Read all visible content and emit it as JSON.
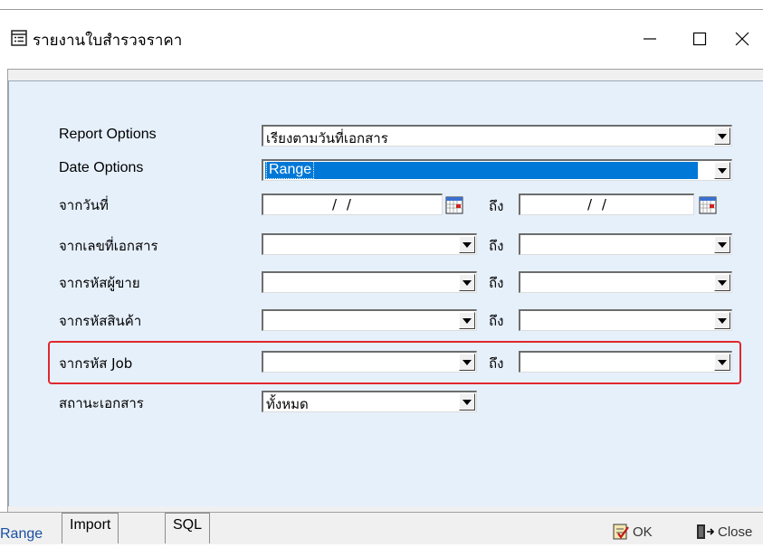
{
  "window": {
    "title": "รายงานใบสำรวจราคา",
    "icon": "report-list-icon",
    "controls": [
      "minimize-icon",
      "maximize-icon",
      "close-icon"
    ]
  },
  "form": {
    "report_options": {
      "label": "Report Options",
      "value": "เรียงตามวันที่เอกสาร"
    },
    "date_options": {
      "label": "Date Options",
      "value": "Range"
    },
    "from_date": {
      "label": "จากวันที่",
      "from_value": "/ /",
      "to_value": "/ /"
    },
    "from_doc_no": {
      "label": "จากเลขที่เอกสาร"
    },
    "from_salesperson": {
      "label": "จากรหัสผู้ขาย"
    },
    "from_product": {
      "label": "จากรหัสสินค้า"
    },
    "from_job": {
      "label": "จากรหัส Job"
    },
    "doc_status": {
      "label": "สถานะเอกสาร",
      "value": "ทั้งหมด"
    },
    "to_label": "ถึง"
  },
  "tabs": [
    "Range",
    "Import",
    "SQL"
  ],
  "buttons": {
    "ok": "OK",
    "close": "Close"
  },
  "colors": {
    "selection": "#0078d7",
    "highlight_border": "#e0282e",
    "panel": "#e6f0fb"
  }
}
